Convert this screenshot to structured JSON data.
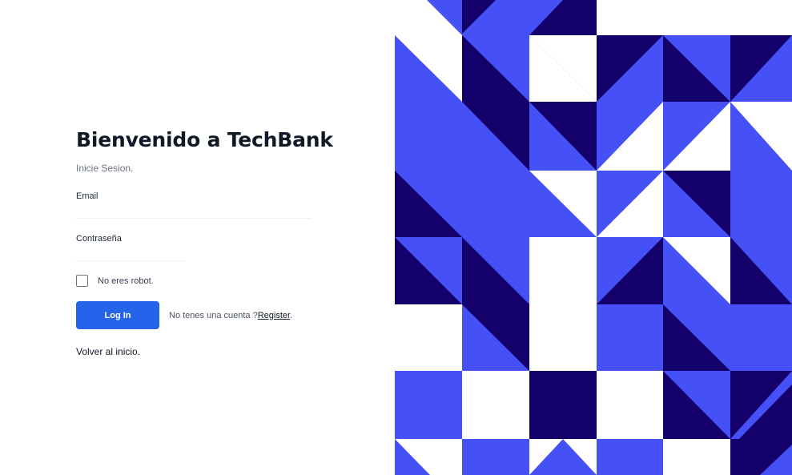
{
  "login": {
    "title": "Bienvenido a TechBank",
    "subtitle": "Inicie Sesion.",
    "email_label": "Email",
    "email_value": "",
    "password_label": "Contraseña",
    "password_value": "",
    "captcha_label": "No eres robot.",
    "login_button": "Log In",
    "register_prompt": "No tenes una cuenta ?",
    "register_link": "Register",
    "register_suffix": ".",
    "back_link": "Volver al inicio."
  },
  "colors": {
    "accent": "#2563eb",
    "pattern_blue": "#4550f7",
    "pattern_navy": "#14006b",
    "pattern_white": "#ffffff"
  }
}
